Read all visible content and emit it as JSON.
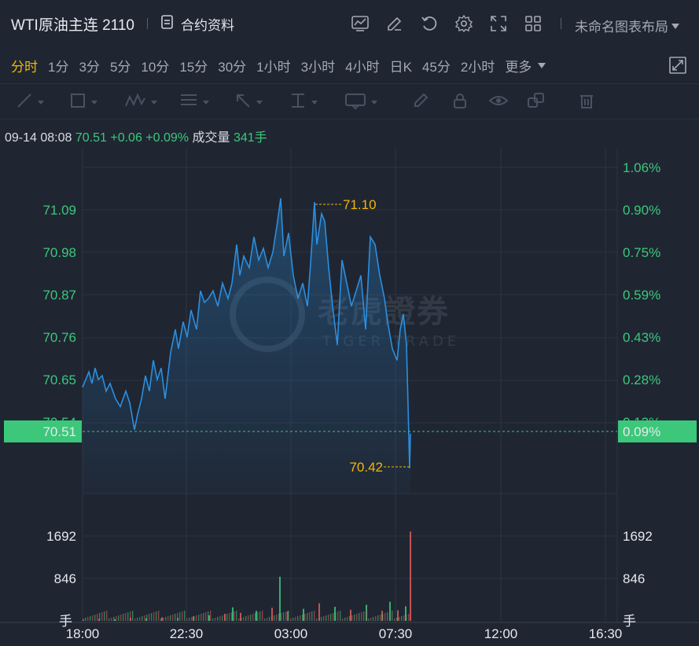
{
  "header": {
    "title": "WTI原油主连 2110",
    "contract_info_label": "合约资料",
    "layout_name": "未命名图表布局"
  },
  "periods": [
    {
      "label": "分时",
      "active": true
    },
    {
      "label": "1分"
    },
    {
      "label": "3分"
    },
    {
      "label": "5分"
    },
    {
      "label": "10分"
    },
    {
      "label": "15分"
    },
    {
      "label": "30分"
    },
    {
      "label": "1小时"
    },
    {
      "label": "3小时"
    },
    {
      "label": "4小时"
    },
    {
      "label": "日K"
    },
    {
      "label": "45分"
    },
    {
      "label": "2小时"
    },
    {
      "label": "更多"
    }
  ],
  "quote": {
    "datetime": "09-14 08:08",
    "price": "70.51",
    "change": "+0.06",
    "change_pct": "+0.09%",
    "volume_label": "成交量",
    "volume": "341手"
  },
  "watermark": {
    "cn": "老虎證券",
    "en": "TIGER TRADE"
  },
  "colors": {
    "up": "#3cc77a",
    "line": "#2b8fe0",
    "highlight": "#f2b704",
    "vol_down": "#e05a5a"
  },
  "chart_data": {
    "type": "line",
    "price_axis_labels": [
      "71.09",
      "70.98",
      "70.87",
      "70.76",
      "70.65",
      "70.54"
    ],
    "percent_axis_labels": [
      "1.06%",
      "0.90%",
      "0.75%",
      "0.59%",
      "0.43%",
      "0.28%",
      "0.13%"
    ],
    "current_price": "70.51",
    "current_pct": "0.09%",
    "high_label": "71.10",
    "low_label": "70.42",
    "volume_axis_labels": [
      "1692",
      "846"
    ],
    "volume_unit": "手",
    "x_labels": [
      "18:00",
      "22:30",
      "03:00",
      "07:30",
      "12:00",
      "16:30"
    ],
    "ylim": [
      70.42,
      71.2
    ],
    "price_series": [
      [
        0,
        70.63
      ],
      [
        8,
        70.67
      ],
      [
        12,
        70.64
      ],
      [
        16,
        70.68
      ],
      [
        20,
        70.65
      ],
      [
        25,
        70.66
      ],
      [
        30,
        70.62
      ],
      [
        35,
        70.64
      ],
      [
        42,
        70.6
      ],
      [
        48,
        70.58
      ],
      [
        55,
        70.62
      ],
      [
        60,
        70.59
      ],
      [
        66,
        70.52
      ],
      [
        70,
        70.56
      ],
      [
        75,
        70.6
      ],
      [
        80,
        70.66
      ],
      [
        85,
        70.62
      ],
      [
        90,
        70.7
      ],
      [
        95,
        70.65
      ],
      [
        100,
        70.68
      ],
      [
        105,
        70.6
      ],
      [
        112,
        70.72
      ],
      [
        118,
        70.78
      ],
      [
        122,
        70.73
      ],
      [
        128,
        70.8
      ],
      [
        133,
        70.76
      ],
      [
        138,
        70.83
      ],
      [
        145,
        70.78
      ],
      [
        150,
        70.88
      ],
      [
        155,
        70.85
      ],
      [
        160,
        70.86
      ],
      [
        166,
        70.88
      ],
      [
        172,
        70.84
      ],
      [
        178,
        70.9
      ],
      [
        185,
        70.86
      ],
      [
        190,
        70.9
      ],
      [
        196,
        71.0
      ],
      [
        200,
        70.92
      ],
      [
        205,
        70.97
      ],
      [
        212,
        70.94
      ],
      [
        218,
        71.02
      ],
      [
        224,
        70.96
      ],
      [
        230,
        70.99
      ],
      [
        236,
        70.94
      ],
      [
        242,
        70.98
      ],
      [
        248,
        71.06
      ],
      [
        252,
        71.12
      ],
      [
        256,
        70.97
      ],
      [
        262,
        71.03
      ],
      [
        268,
        70.92
      ],
      [
        274,
        70.86
      ],
      [
        280,
        70.9
      ],
      [
        286,
        70.84
      ],
      [
        290,
        70.95
      ],
      [
        295,
        71.11
      ],
      [
        298,
        71.0
      ],
      [
        304,
        71.08
      ],
      [
        308,
        71.06
      ],
      [
        313,
        70.94
      ],
      [
        318,
        70.84
      ],
      [
        324,
        70.74
      ],
      [
        330,
        70.96
      ],
      [
        336,
        70.9
      ],
      [
        342,
        70.84
      ],
      [
        348,
        70.88
      ],
      [
        354,
        70.92
      ],
      [
        360,
        70.78
      ],
      [
        366,
        71.02
      ],
      [
        372,
        71.0
      ],
      [
        378,
        70.92
      ],
      [
        384,
        70.86
      ],
      [
        388,
        70.8
      ],
      [
        394,
        70.73
      ],
      [
        400,
        70.7
      ],
      [
        404,
        70.78
      ],
      [
        408,
        70.82
      ],
      [
        412,
        70.74
      ],
      [
        416,
        70.42
      ],
      [
        417,
        70.51
      ]
    ],
    "volume_series": [
      [
        0,
        20
      ],
      [
        20,
        40
      ],
      [
        40,
        30
      ],
      [
        60,
        60
      ],
      [
        80,
        50
      ],
      [
        100,
        70
      ],
      [
        120,
        60
      ],
      [
        140,
        90
      ],
      [
        160,
        110
      ],
      [
        180,
        140
      ],
      [
        190,
        270
      ],
      [
        200,
        160
      ],
      [
        220,
        200
      ],
      [
        240,
        260
      ],
      [
        250,
        880
      ],
      [
        260,
        190
      ],
      [
        280,
        240
      ],
      [
        300,
        350
      ],
      [
        320,
        280
      ],
      [
        340,
        220
      ],
      [
        360,
        320
      ],
      [
        380,
        200
      ],
      [
        390,
        380
      ],
      [
        400,
        210
      ],
      [
        410,
        290
      ],
      [
        416,
        1780
      ]
    ]
  }
}
